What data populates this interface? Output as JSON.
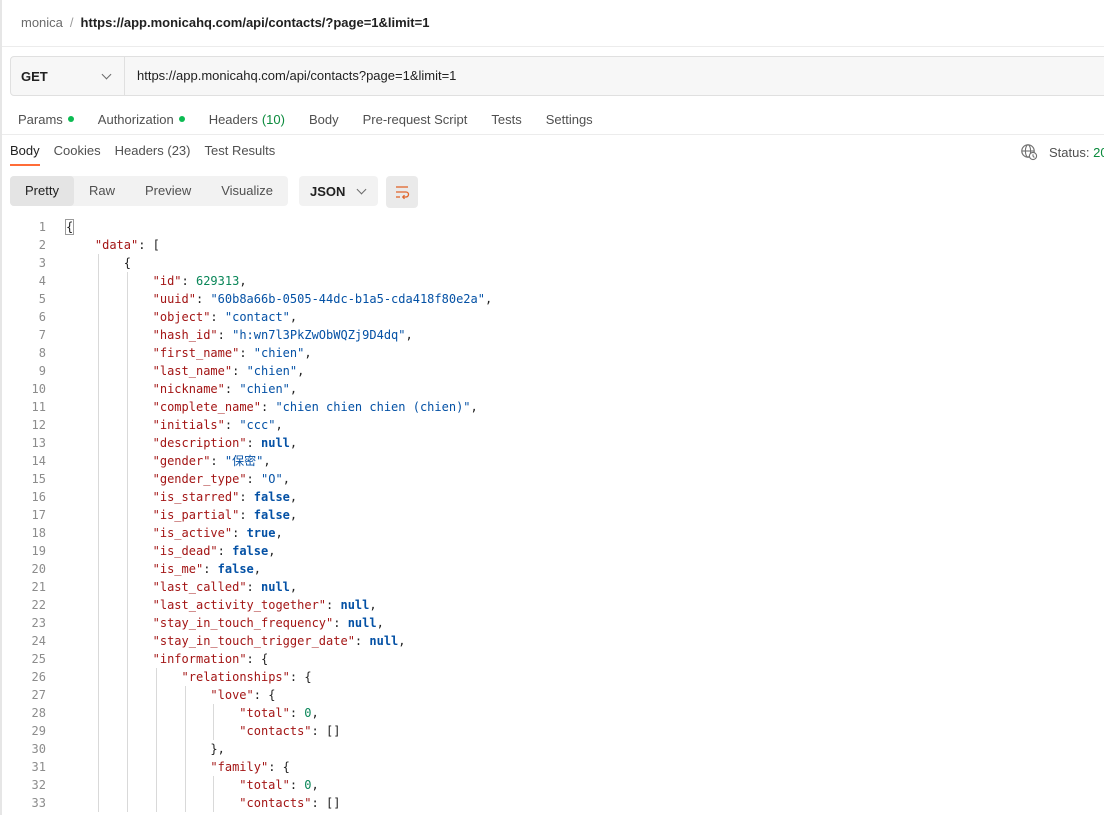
{
  "breadcrumb": {
    "workspace": "monica",
    "separator": "/",
    "current": "https://app.monicahq.com/api/contacts/?page=1&limit=1"
  },
  "request": {
    "method": "GET",
    "url": "https://app.monicahq.com/api/contacts?page=1&limit=1"
  },
  "request_tabs": [
    {
      "label": "Params",
      "dot": true,
      "count": ""
    },
    {
      "label": "Authorization",
      "dot": true,
      "count": ""
    },
    {
      "label": "Headers",
      "dot": false,
      "count": "(10)"
    },
    {
      "label": "Body",
      "dot": false,
      "count": ""
    },
    {
      "label": "Pre-request Script",
      "dot": false,
      "count": ""
    },
    {
      "label": "Tests",
      "dot": false,
      "count": ""
    },
    {
      "label": "Settings",
      "dot": false,
      "count": ""
    }
  ],
  "response_tabs": [
    {
      "label": "Body",
      "active": true
    },
    {
      "label": "Cookies",
      "active": false
    },
    {
      "label": "Headers (23)",
      "active": false
    },
    {
      "label": "Test Results",
      "active": false
    }
  ],
  "status": {
    "label": "Status:",
    "code": "20"
  },
  "view_modes": [
    {
      "label": "Pretty",
      "active": true
    },
    {
      "label": "Raw",
      "active": false
    },
    {
      "label": "Preview",
      "active": false
    },
    {
      "label": "Visualize",
      "active": false
    }
  ],
  "format": {
    "selected": "JSON"
  },
  "icons": {
    "method_dropdown": "chevron-down-icon",
    "format_dropdown": "chevron-down-icon",
    "status": "globe-icon",
    "wrap": "wrap-lines-icon"
  },
  "colors": {
    "accent": "#ff6c37",
    "dot": "#0cbb52",
    "count": "#0a8a3c",
    "key": "#a31515",
    "string": "#0451a5",
    "number": "#098658"
  },
  "code_lines": [
    {
      "n": "1",
      "i": 0,
      "parts": [
        {
          "t": "p",
          "v": "{"
        }
      ]
    },
    {
      "n": "2",
      "i": 1,
      "parts": [
        {
          "t": "k",
          "v": "\"data\""
        },
        {
          "t": "p",
          "v": ": ["
        }
      ]
    },
    {
      "n": "3",
      "i": 2,
      "parts": [
        {
          "t": "p",
          "v": "{"
        }
      ]
    },
    {
      "n": "4",
      "i": 3,
      "parts": [
        {
          "t": "k",
          "v": "\"id\""
        },
        {
          "t": "p",
          "v": ": "
        },
        {
          "t": "n",
          "v": "629313"
        },
        {
          "t": "p",
          "v": ","
        }
      ]
    },
    {
      "n": "5",
      "i": 3,
      "parts": [
        {
          "t": "k",
          "v": "\"uuid\""
        },
        {
          "t": "p",
          "v": ": "
        },
        {
          "t": "s",
          "v": "\"60b8a66b-0505-44dc-b1a5-cda418f80e2a\""
        },
        {
          "t": "p",
          "v": ","
        }
      ]
    },
    {
      "n": "6",
      "i": 3,
      "parts": [
        {
          "t": "k",
          "v": "\"object\""
        },
        {
          "t": "p",
          "v": ": "
        },
        {
          "t": "s",
          "v": "\"contact\""
        },
        {
          "t": "p",
          "v": ","
        }
      ]
    },
    {
      "n": "7",
      "i": 3,
      "parts": [
        {
          "t": "k",
          "v": "\"hash_id\""
        },
        {
          "t": "p",
          "v": ": "
        },
        {
          "t": "s",
          "v": "\"h:wn7l3PkZwObWQZj9D4dq\""
        },
        {
          "t": "p",
          "v": ","
        }
      ]
    },
    {
      "n": "8",
      "i": 3,
      "parts": [
        {
          "t": "k",
          "v": "\"first_name\""
        },
        {
          "t": "p",
          "v": ": "
        },
        {
          "t": "s",
          "v": "\"chien\""
        },
        {
          "t": "p",
          "v": ","
        }
      ]
    },
    {
      "n": "9",
      "i": 3,
      "parts": [
        {
          "t": "k",
          "v": "\"last_name\""
        },
        {
          "t": "p",
          "v": ": "
        },
        {
          "t": "s",
          "v": "\"chien\""
        },
        {
          "t": "p",
          "v": ","
        }
      ]
    },
    {
      "n": "10",
      "i": 3,
      "parts": [
        {
          "t": "k",
          "v": "\"nickname\""
        },
        {
          "t": "p",
          "v": ": "
        },
        {
          "t": "s",
          "v": "\"chien\""
        },
        {
          "t": "p",
          "v": ","
        }
      ]
    },
    {
      "n": "11",
      "i": 3,
      "parts": [
        {
          "t": "k",
          "v": "\"complete_name\""
        },
        {
          "t": "p",
          "v": ": "
        },
        {
          "t": "s",
          "v": "\"chien chien chien (chien)\""
        },
        {
          "t": "p",
          "v": ","
        }
      ]
    },
    {
      "n": "12",
      "i": 3,
      "parts": [
        {
          "t": "k",
          "v": "\"initials\""
        },
        {
          "t": "p",
          "v": ": "
        },
        {
          "t": "s",
          "v": "\"ccc\""
        },
        {
          "t": "p",
          "v": ","
        }
      ]
    },
    {
      "n": "13",
      "i": 3,
      "parts": [
        {
          "t": "k",
          "v": "\"description\""
        },
        {
          "t": "p",
          "v": ": "
        },
        {
          "t": "b",
          "v": "null"
        },
        {
          "t": "p",
          "v": ","
        }
      ]
    },
    {
      "n": "14",
      "i": 3,
      "parts": [
        {
          "t": "k",
          "v": "\"gender\""
        },
        {
          "t": "p",
          "v": ": "
        },
        {
          "t": "s",
          "v": "\"保密\""
        },
        {
          "t": "p",
          "v": ","
        }
      ]
    },
    {
      "n": "15",
      "i": 3,
      "parts": [
        {
          "t": "k",
          "v": "\"gender_type\""
        },
        {
          "t": "p",
          "v": ": "
        },
        {
          "t": "s",
          "v": "\"O\""
        },
        {
          "t": "p",
          "v": ","
        }
      ]
    },
    {
      "n": "16",
      "i": 3,
      "parts": [
        {
          "t": "k",
          "v": "\"is_starred\""
        },
        {
          "t": "p",
          "v": ": "
        },
        {
          "t": "b",
          "v": "false"
        },
        {
          "t": "p",
          "v": ","
        }
      ]
    },
    {
      "n": "17",
      "i": 3,
      "parts": [
        {
          "t": "k",
          "v": "\"is_partial\""
        },
        {
          "t": "p",
          "v": ": "
        },
        {
          "t": "b",
          "v": "false"
        },
        {
          "t": "p",
          "v": ","
        }
      ]
    },
    {
      "n": "18",
      "i": 3,
      "parts": [
        {
          "t": "k",
          "v": "\"is_active\""
        },
        {
          "t": "p",
          "v": ": "
        },
        {
          "t": "b",
          "v": "true"
        },
        {
          "t": "p",
          "v": ","
        }
      ]
    },
    {
      "n": "19",
      "i": 3,
      "parts": [
        {
          "t": "k",
          "v": "\"is_dead\""
        },
        {
          "t": "p",
          "v": ": "
        },
        {
          "t": "b",
          "v": "false"
        },
        {
          "t": "p",
          "v": ","
        }
      ]
    },
    {
      "n": "20",
      "i": 3,
      "parts": [
        {
          "t": "k",
          "v": "\"is_me\""
        },
        {
          "t": "p",
          "v": ": "
        },
        {
          "t": "b",
          "v": "false"
        },
        {
          "t": "p",
          "v": ","
        }
      ]
    },
    {
      "n": "21",
      "i": 3,
      "parts": [
        {
          "t": "k",
          "v": "\"last_called\""
        },
        {
          "t": "p",
          "v": ": "
        },
        {
          "t": "b",
          "v": "null"
        },
        {
          "t": "p",
          "v": ","
        }
      ]
    },
    {
      "n": "22",
      "i": 3,
      "parts": [
        {
          "t": "k",
          "v": "\"last_activity_together\""
        },
        {
          "t": "p",
          "v": ": "
        },
        {
          "t": "b",
          "v": "null"
        },
        {
          "t": "p",
          "v": ","
        }
      ]
    },
    {
      "n": "23",
      "i": 3,
      "parts": [
        {
          "t": "k",
          "v": "\"stay_in_touch_frequency\""
        },
        {
          "t": "p",
          "v": ": "
        },
        {
          "t": "b",
          "v": "null"
        },
        {
          "t": "p",
          "v": ","
        }
      ]
    },
    {
      "n": "24",
      "i": 3,
      "parts": [
        {
          "t": "k",
          "v": "\"stay_in_touch_trigger_date\""
        },
        {
          "t": "p",
          "v": ": "
        },
        {
          "t": "b",
          "v": "null"
        },
        {
          "t": "p",
          "v": ","
        }
      ]
    },
    {
      "n": "25",
      "i": 3,
      "parts": [
        {
          "t": "k",
          "v": "\"information\""
        },
        {
          "t": "p",
          "v": ": {"
        }
      ]
    },
    {
      "n": "26",
      "i": 4,
      "parts": [
        {
          "t": "k",
          "v": "\"relationships\""
        },
        {
          "t": "p",
          "v": ": {"
        }
      ]
    },
    {
      "n": "27",
      "i": 5,
      "parts": [
        {
          "t": "k",
          "v": "\"love\""
        },
        {
          "t": "p",
          "v": ": {"
        }
      ]
    },
    {
      "n": "28",
      "i": 6,
      "parts": [
        {
          "t": "k",
          "v": "\"total\""
        },
        {
          "t": "p",
          "v": ": "
        },
        {
          "t": "n",
          "v": "0"
        },
        {
          "t": "p",
          "v": ","
        }
      ]
    },
    {
      "n": "29",
      "i": 6,
      "parts": [
        {
          "t": "k",
          "v": "\"contacts\""
        },
        {
          "t": "p",
          "v": ": []"
        }
      ]
    },
    {
      "n": "30",
      "i": 5,
      "parts": [
        {
          "t": "p",
          "v": "},"
        }
      ]
    },
    {
      "n": "31",
      "i": 5,
      "parts": [
        {
          "t": "k",
          "v": "\"family\""
        },
        {
          "t": "p",
          "v": ": {"
        }
      ]
    },
    {
      "n": "32",
      "i": 6,
      "parts": [
        {
          "t": "k",
          "v": "\"total\""
        },
        {
          "t": "p",
          "v": ": "
        },
        {
          "t": "n",
          "v": "0"
        },
        {
          "t": "p",
          "v": ","
        }
      ]
    },
    {
      "n": "33",
      "i": 6,
      "parts": [
        {
          "t": "k",
          "v": "\"contacts\""
        },
        {
          "t": "p",
          "v": ": []"
        }
      ]
    }
  ]
}
